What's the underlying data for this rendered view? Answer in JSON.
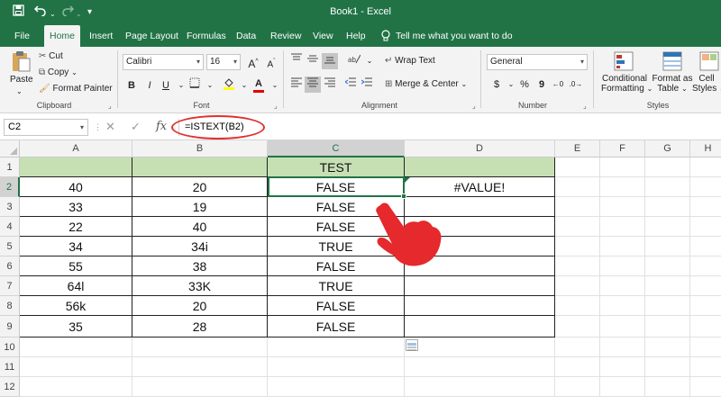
{
  "window": {
    "title": "Book1  -  Excel"
  },
  "quick_access": {
    "save_icon": "save-icon",
    "undo_icon": "undo-icon",
    "redo_icon": "redo-icon"
  },
  "tabs": [
    "File",
    "Home",
    "Insert",
    "Page Layout",
    "Formulas",
    "Data",
    "Review",
    "View",
    "Help"
  ],
  "active_tab": "Home",
  "tell_me": "Tell me what you want to do",
  "ribbon": {
    "clipboard": {
      "paste": "Paste",
      "cut": "Cut",
      "copy": "Copy",
      "format_painter": "Format Painter",
      "label": "Clipboard"
    },
    "font": {
      "name": "Calibri",
      "size": "16",
      "bold": "B",
      "italic": "I",
      "underline": "U",
      "label": "Font"
    },
    "alignment": {
      "wrap": "Wrap Text",
      "merge": "Merge & Center",
      "label": "Alignment"
    },
    "number": {
      "format": "General",
      "currency": "$",
      "percent": "%",
      "comma": "9",
      "label": "Number"
    },
    "styles": {
      "conditional_1": "Conditional",
      "conditional_2": "Formatting",
      "format_table_1": "Format as",
      "format_table_2": "Table",
      "cell_styles_1": "Cell",
      "cell_styles_2": "Styles",
      "label": "Styles"
    }
  },
  "formula_bar": {
    "name_box": "C2",
    "fx": "fx",
    "formula": "=ISTEXT(B2)"
  },
  "grid": {
    "columns": [
      "A",
      "B",
      "C",
      "D",
      "E",
      "F",
      "G",
      "H"
    ],
    "rows": [
      "1",
      "2",
      "3",
      "4",
      "5",
      "6",
      "7",
      "8",
      "9",
      "10",
      "11",
      "12"
    ],
    "active_cell": "C2",
    "header_C": "TEST",
    "col_A": [
      "40",
      "33",
      "22",
      "34",
      "55",
      "64l",
      "56k",
      "35"
    ],
    "col_B": [
      "20",
      "19",
      "40",
      "34i",
      "38",
      "33K",
      "20",
      "28"
    ],
    "col_C": [
      "FALSE",
      "FALSE",
      "FALSE",
      "TRUE",
      "FALSE",
      "TRUE",
      "FALSE",
      "FALSE"
    ],
    "D2": "#VALUE!"
  },
  "colors": {
    "excel_green": "#217346",
    "header_fill": "#c6e0b4",
    "annotation_red": "#e03030"
  }
}
